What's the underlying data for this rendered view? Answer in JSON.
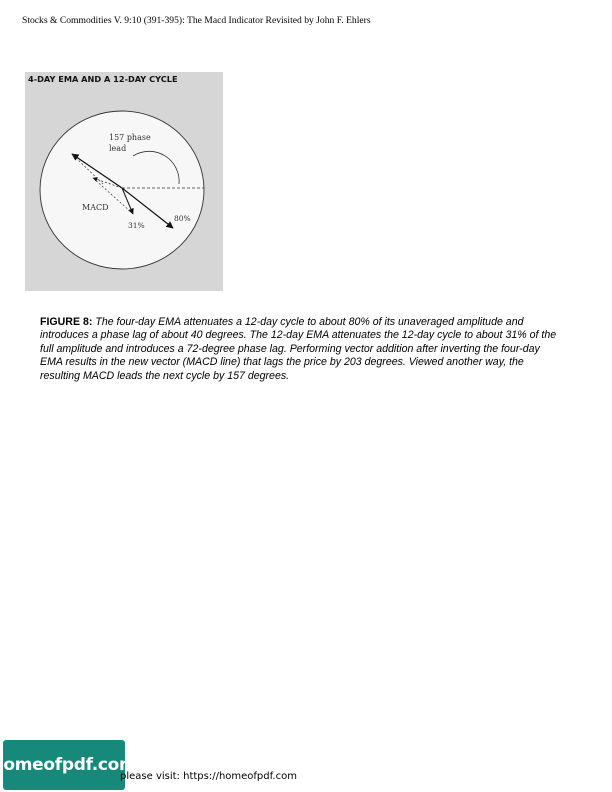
{
  "header": {
    "running_title": "Stocks & Commodities V. 9:10 (391-395): The Macd Indicator Revisited by John F. Ehlers"
  },
  "figure": {
    "title": "4-DAY EMA AND A 12-DAY CYCLE",
    "phase_label_line1": "157 phase",
    "phase_label_line2": "lead",
    "macd_label": "MACD",
    "label_80": "80%",
    "label_31": "31%"
  },
  "caption": {
    "label": "FIGURE 8:",
    "text": "The four-day EMA attenuates a 12-day cycle to about 80% of its unaveraged amplitude and introduces a phase lag of about 40 degrees. The 12-day EMA attenuates the 12-day cycle to about 31% of the full amplitude and introduces a 72-degree phase lag. Performing vector addition after inverting the four-day EMA results in the new vector (MACD line) that lags the price by 203 degrees. Viewed another way, the resulting MACD leads the next cycle by 157 degrees."
  },
  "footer": {
    "logo_text": "homeofpdf.com",
    "visit_text": "please visit: https://homeofpdf.com"
  },
  "colors": {
    "figure_bg": "#d6d6d6",
    "banner_bg": "#16897a"
  }
}
